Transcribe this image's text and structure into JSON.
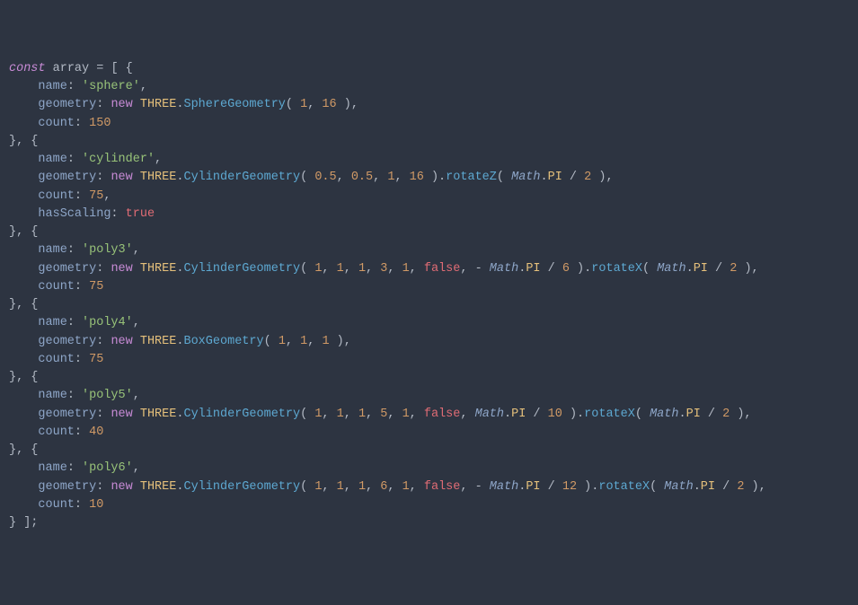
{
  "code": {
    "keyword_const": "const",
    "keyword_new": "new",
    "var_name": "array",
    "class_three": "THREE",
    "class_sphere": "SphereGeometry",
    "class_cylinder": "CylinderGeometry",
    "class_box": "BoxGeometry",
    "method_rotateZ": "rotateZ",
    "method_rotateX": "rotateX",
    "const_math": "Math",
    "const_pi": "PI",
    "items": [
      {
        "name_key": "name",
        "name_val": "'sphere'",
        "geometry_key": "geometry",
        "geom_ctor": "SphereGeometry",
        "geom_args": [
          "1",
          "16"
        ],
        "count_key": "count",
        "count_val": "150"
      },
      {
        "name_key": "name",
        "name_val": "'cylinder'",
        "geometry_key": "geometry",
        "geom_ctor": "CylinderGeometry",
        "geom_args": [
          "0.5",
          "0.5",
          "1",
          "16"
        ],
        "rotate_method": "rotateZ",
        "rotate_div": "2",
        "count_key": "count",
        "count_val": "75",
        "hasScaling_key": "hasScaling",
        "hasScaling_val": "true"
      },
      {
        "name_key": "name",
        "name_val": "'poly3'",
        "geometry_key": "geometry",
        "geom_ctor": "CylinderGeometry",
        "geom_args_pre": [
          "1",
          "1",
          "1",
          "3",
          "1"
        ],
        "geom_false": "false",
        "geom_sign": "- ",
        "geom_pi_div": "6",
        "rotate_method": "rotateX",
        "rotate_div": "2",
        "count_key": "count",
        "count_val": "75"
      },
      {
        "name_key": "name",
        "name_val": "'poly4'",
        "geometry_key": "geometry",
        "geom_ctor": "BoxGeometry",
        "geom_args": [
          "1",
          "1",
          "1"
        ],
        "count_key": "count",
        "count_val": "75"
      },
      {
        "name_key": "name",
        "name_val": "'poly5'",
        "geometry_key": "geometry",
        "geom_ctor": "CylinderGeometry",
        "geom_args_pre": [
          "1",
          "1",
          "1",
          "5",
          "1"
        ],
        "geom_false": "false",
        "geom_sign": "",
        "geom_pi_div": "10",
        "rotate_method": "rotateX",
        "rotate_div": "2",
        "count_key": "count",
        "count_val": "40"
      },
      {
        "name_key": "name",
        "name_val": "'poly6'",
        "geometry_key": "geometry",
        "geom_ctor": "CylinderGeometry",
        "geom_args_pre": [
          "1",
          "1",
          "1",
          "6",
          "1"
        ],
        "geom_false": "false",
        "geom_sign": "- ",
        "geom_pi_div": "12",
        "rotate_method": "rotateX",
        "rotate_div": "2",
        "count_key": "count",
        "count_val": "10"
      }
    ]
  }
}
